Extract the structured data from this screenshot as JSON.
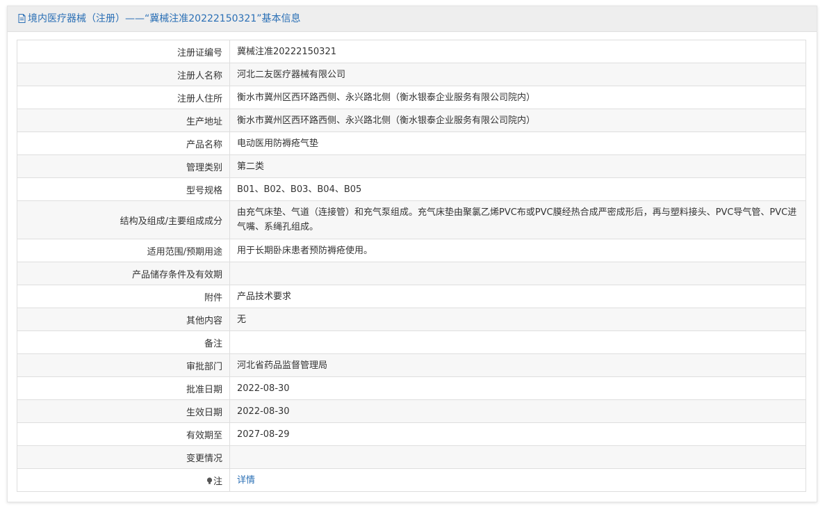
{
  "header": {
    "title": "境内医疗器械（注册）——“冀械注准20222150321”基本信息"
  },
  "rows": [
    {
      "label": "注册证编号",
      "value": "冀械注准20222150321"
    },
    {
      "label": "注册人名称",
      "value": "河北二友医疗器械有限公司"
    },
    {
      "label": "注册人住所",
      "value": "衡水市冀州区西环路西侧、永兴路北侧（衡水银泰企业服务有限公司院内）"
    },
    {
      "label": "生产地址",
      "value": "衡水市冀州区西环路西侧、永兴路北侧（衡水银泰企业服务有限公司院内）"
    },
    {
      "label": "产品名称",
      "value": "电动医用防褥疮气垫"
    },
    {
      "label": "管理类别",
      "value": "第二类"
    },
    {
      "label": "型号规格",
      "value": "B01、B02、B03、B04、B05"
    },
    {
      "label": "结构及组成/主要组成成分",
      "value": "由充气床垫、气道（连接管）和充气泵组成。充气床垫由聚氯乙烯PVC布或PVC膜经热合成严密成形后，再与塑料接头、PVC导气管、PVC进气嘴、系绳孔组成。"
    },
    {
      "label": "适用范围/预期用途",
      "value": "用于长期卧床患者预防褥疮使用。"
    },
    {
      "label": "产品储存条件及有效期",
      "value": ""
    },
    {
      "label": "附件",
      "value": "产品技术要求"
    },
    {
      "label": "其他内容",
      "value": "无"
    },
    {
      "label": "备注",
      "value": ""
    },
    {
      "label": "审批部门",
      "value": "河北省药品监督管理局"
    },
    {
      "label": "批准日期",
      "value": "2022-08-30"
    },
    {
      "label": "生效日期",
      "value": "2022-08-30"
    },
    {
      "label": "有效期至",
      "value": "2027-08-29"
    },
    {
      "label": "变更情况",
      "value": ""
    }
  ],
  "note": {
    "label": "注",
    "icon": "bulb-icon",
    "link_text": "详情"
  },
  "colors": {
    "accent": "#2a6fb5",
    "header_bg": "#eeeeee",
    "row_alt_bg": "#f7f7f7",
    "border": "#dedede"
  }
}
